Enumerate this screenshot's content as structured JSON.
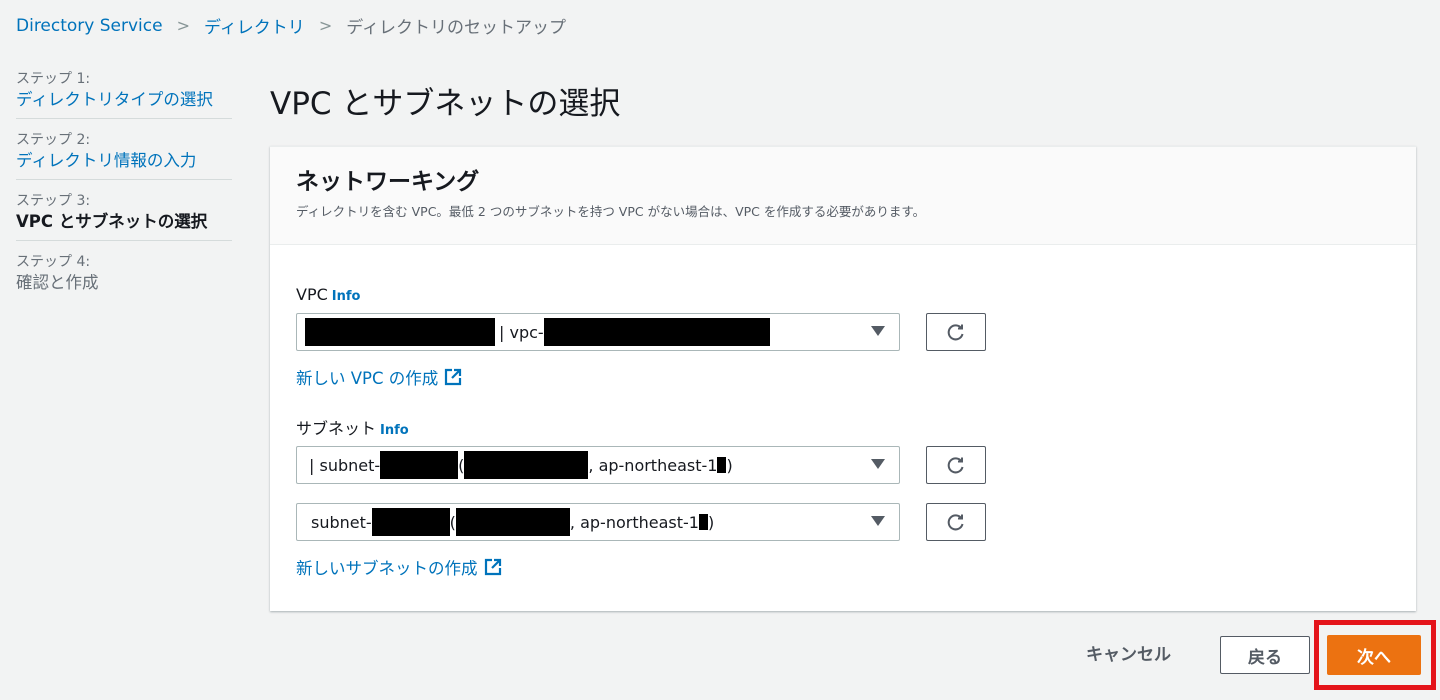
{
  "breadcrumb": {
    "items": [
      "Directory Service",
      "ディレクトリ",
      "ディレクトリのセットアップ"
    ]
  },
  "steps": [
    {
      "num": "ステップ 1:",
      "label": "ディレクトリタイプの選択"
    },
    {
      "num": "ステップ 2:",
      "label": "ディレクトリ情報の入力"
    },
    {
      "num": "ステップ 3:",
      "label": "VPC とサブネットの選択"
    },
    {
      "num": "ステップ 4:",
      "label": "確認と作成"
    }
  ],
  "page": {
    "title": "VPC とサブネットの選択"
  },
  "networking": {
    "title": "ネットワーキング",
    "description": "ディレクトリを含む VPC。最低 2 つのサブネットを持つ VPC がない場合は、VPC を作成する必要があります。",
    "vpc": {
      "label": "VPC",
      "info": "Info",
      "value_parts": [
        "| vpc-"
      ],
      "create_link": "新しい VPC の作成"
    },
    "subnet": {
      "label": "サブネット",
      "info": "Info",
      "select1": {
        "prefix": "| subnet-",
        "open": " (",
        "region": ", ap-northeast-1",
        "close": ")"
      },
      "select2": {
        "prefix": "subnet-",
        "open": " (",
        "region": ", ap-northeast-1",
        "close": ")"
      },
      "create_link": "新しいサブネットの作成"
    }
  },
  "actions": {
    "cancel": "キャンセル",
    "back": "戻る",
    "next": "次へ"
  },
  "colors": {
    "link": "#0073bb",
    "primary_button": "#ec7211",
    "highlight": "#e4141b"
  }
}
